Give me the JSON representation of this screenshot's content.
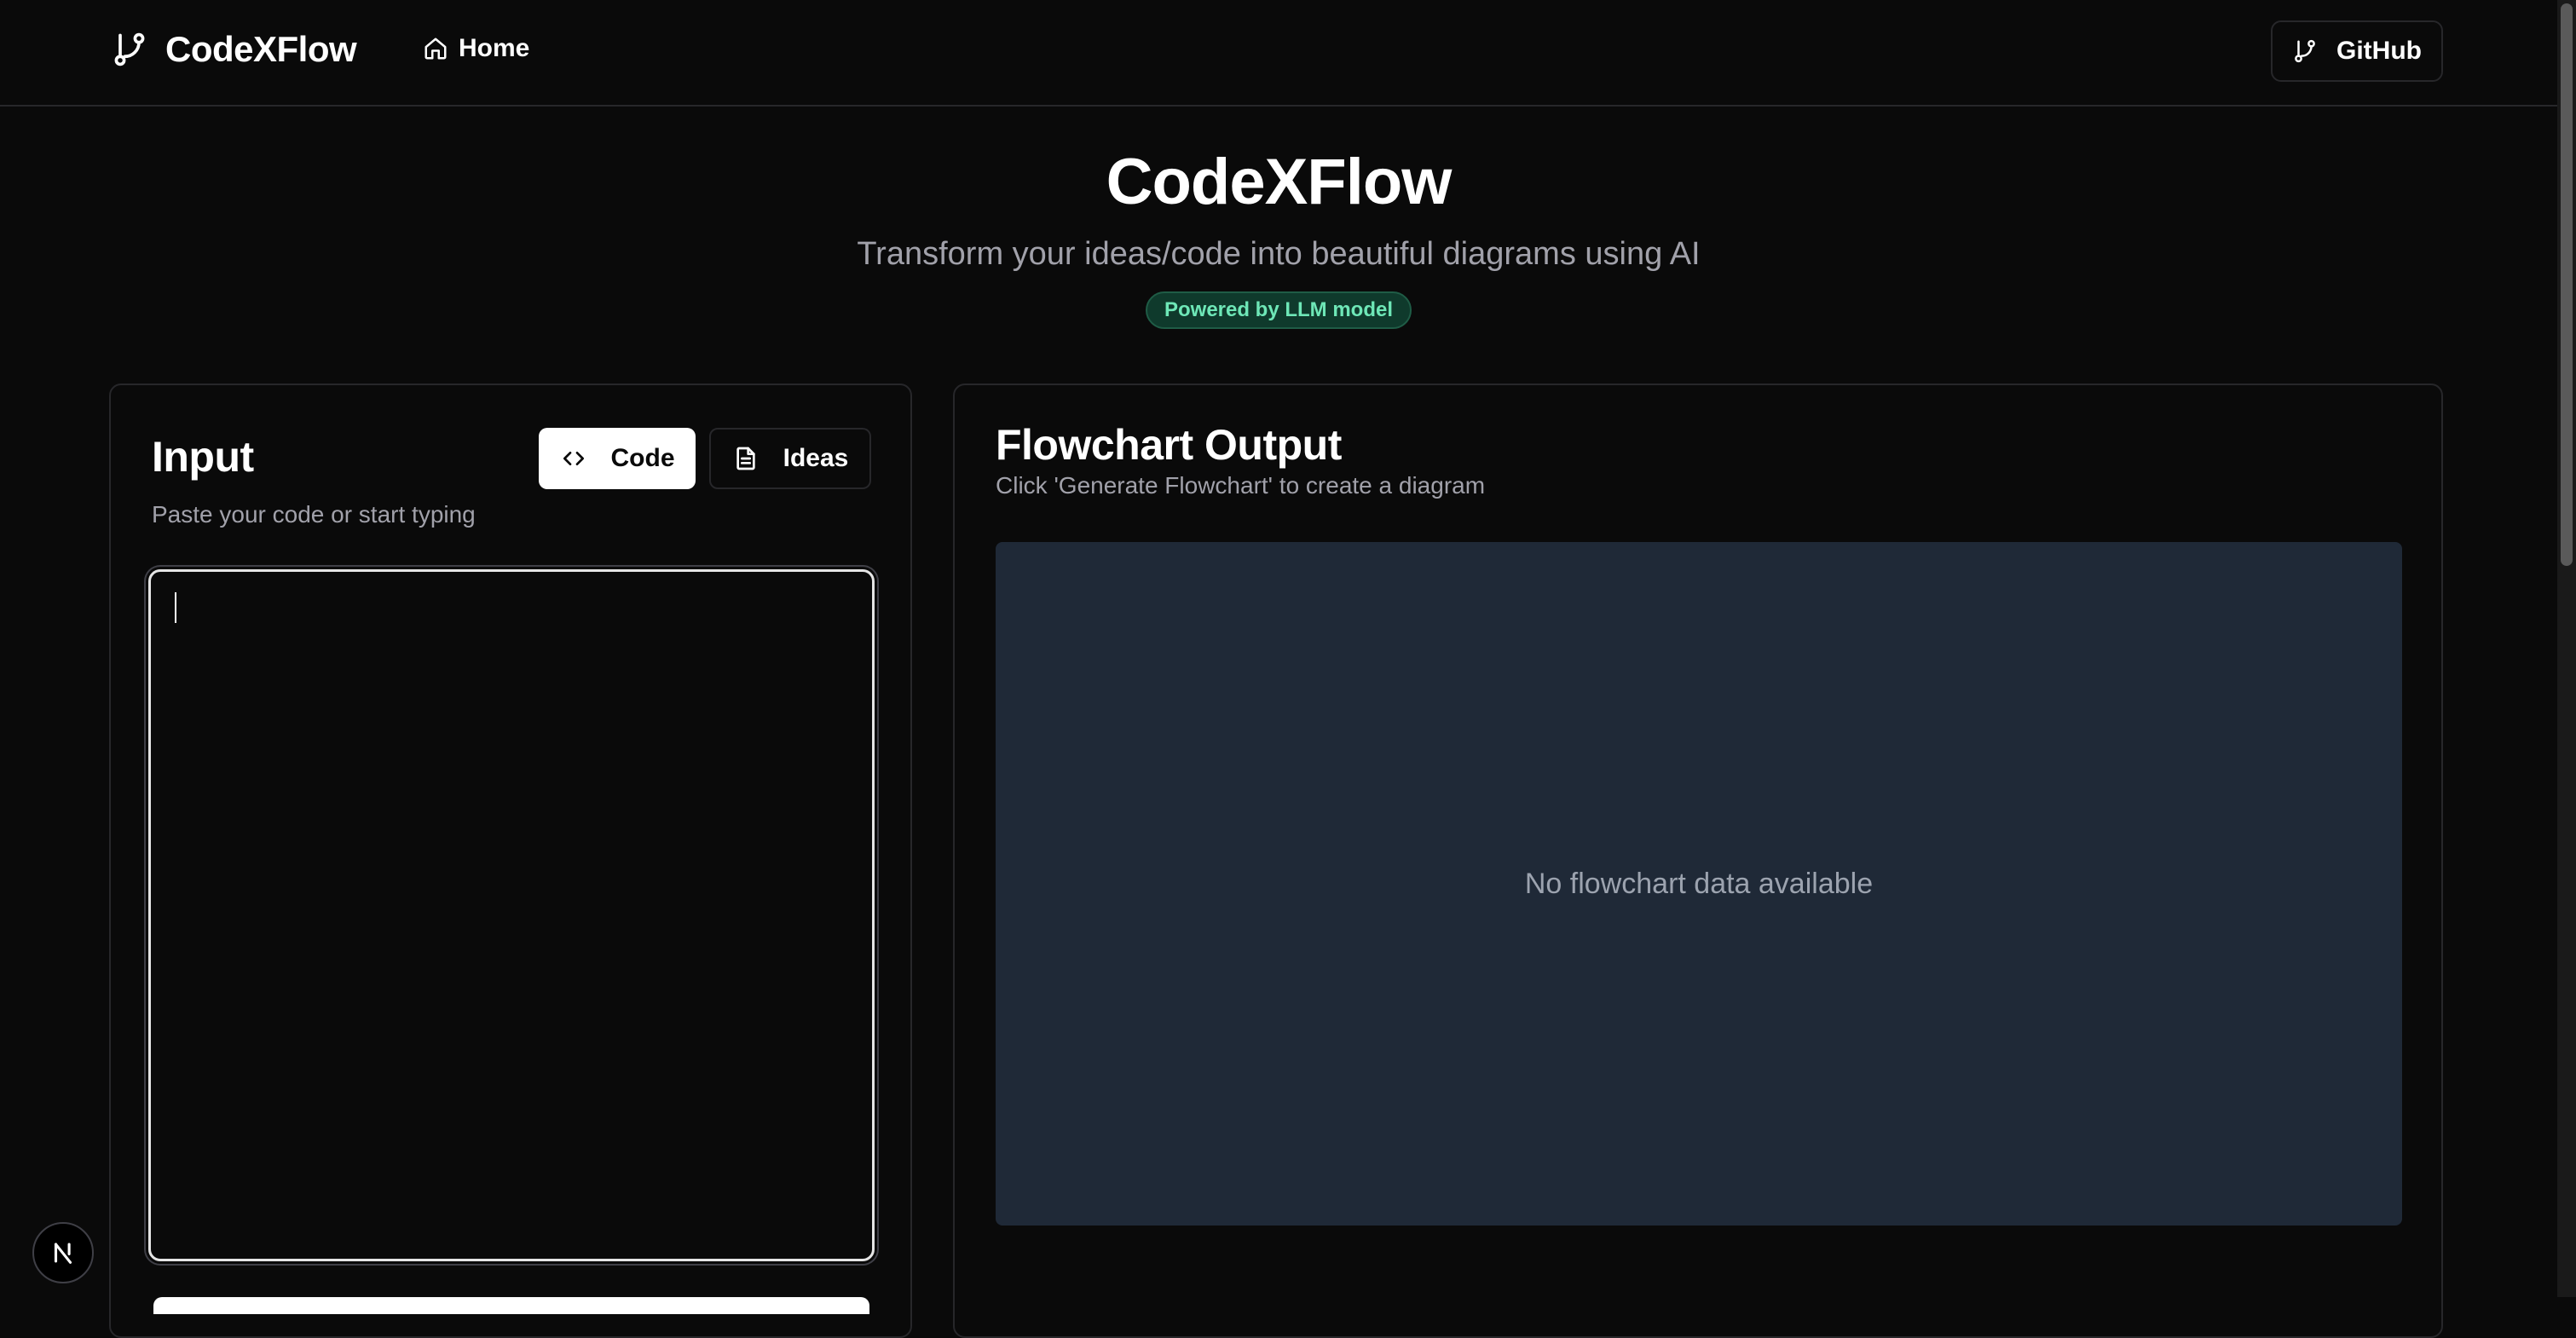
{
  "navbar": {
    "brand": "CodeXFlow",
    "brand_icon": "git-branch-icon",
    "home_label": "Home",
    "home_icon": "home-icon",
    "github_label": "GitHub",
    "github_icon": "git-branch-icon"
  },
  "hero": {
    "title": "CodeXFlow",
    "subtitle": "Transform your ideas/code into beautiful diagrams using AI",
    "badge": "Powered by LLM model"
  },
  "input_card": {
    "title": "Input",
    "description": "Paste your code or start typing",
    "mode_tabs": [
      {
        "label": "Code",
        "icon": "code-brackets-icon",
        "active": true
      },
      {
        "label": "Ideas",
        "icon": "document-icon",
        "active": false
      }
    ],
    "textarea_value": ""
  },
  "output_card": {
    "title": "Flowchart Output",
    "description": "Click 'Generate Flowchart' to create a diagram",
    "empty_message": "No flowchart data available"
  },
  "colors": {
    "background": "#0a0a0a",
    "border": "#27272a",
    "muted_text": "#a1a1aa",
    "panel": "#1f2937",
    "badge_bg": "#0f3a2c",
    "badge_text": "#6ee7b7"
  }
}
